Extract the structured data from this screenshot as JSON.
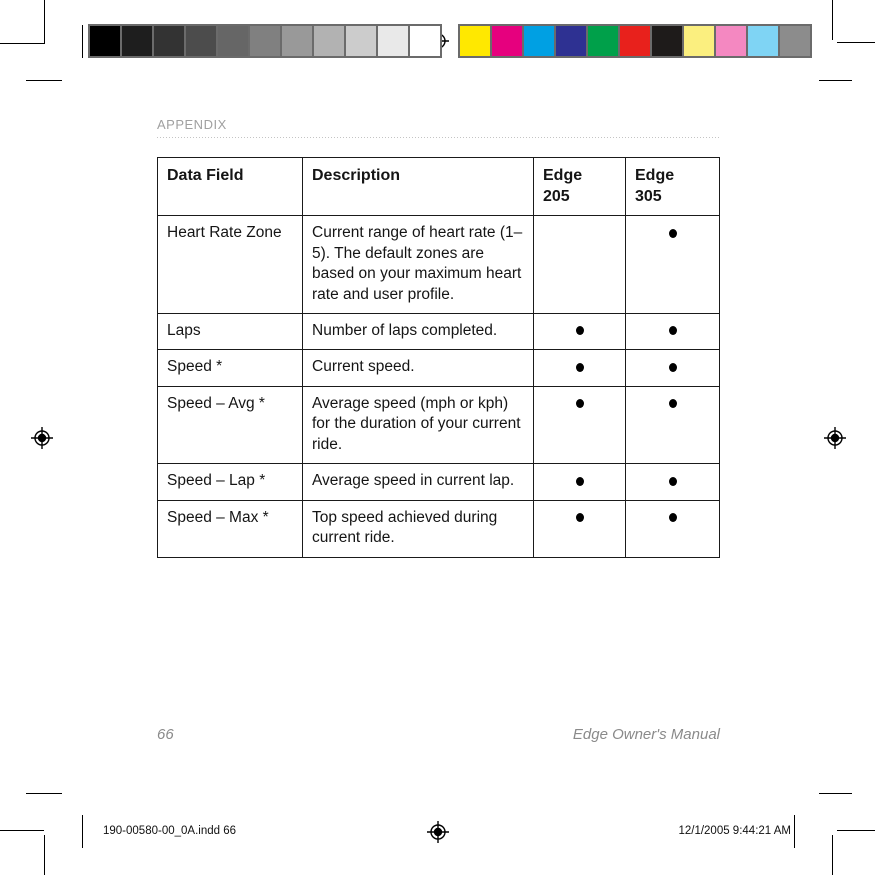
{
  "page": {
    "running_head": "APPENDIX",
    "folio": "66",
    "footer_title": "Edge Owner's Manual"
  },
  "slug": {
    "left": "190-00580-00_0A.indd   66",
    "right": "12/1/2005   9:44:21 AM"
  },
  "table": {
    "headers": [
      "Data Field",
      "Description",
      "Edge\n205",
      "Edge\n305"
    ],
    "header_data_field": "Data Field",
    "header_description": "Description",
    "header_edge205_line1": "Edge",
    "header_edge205_line2": "205",
    "header_edge305_line1": "Edge",
    "header_edge305_line2": "305",
    "rows": [
      {
        "field": "Heart Rate Zone",
        "description": "Current range of heart rate (1–5). The default zones are based on your maximum heart rate and user profile.",
        "edge205": false,
        "edge305": true
      },
      {
        "field": "Laps",
        "description": "Number of laps completed.",
        "edge205": true,
        "edge305": true
      },
      {
        "field": "Speed *",
        "description": "Current speed.",
        "edge205": true,
        "edge305": true
      },
      {
        "field": "Speed – Avg *",
        "description": "Average speed (mph or kph) for the duration of your current ride.",
        "edge205": true,
        "edge305": true
      },
      {
        "field": "Speed – Lap *",
        "description": "Average speed in current lap.",
        "edge205": true,
        "edge305": true
      },
      {
        "field": "Speed – Max *",
        "description": "Top speed achieved during current ride.",
        "edge205": true,
        "edge305": true
      }
    ]
  },
  "calibration": {
    "grayscale_label": "grayscale-step-wedge",
    "grayscale_swatches": [
      "#000000",
      "#1e1e1e",
      "#333333",
      "#4c4c4c",
      "#666666",
      "#808080",
      "#999999",
      "#b2b2b2",
      "#cccccc",
      "#e9e9e9",
      "#ffffff"
    ],
    "color_label": "process-color-bar",
    "color_swatches": [
      "#ffe800",
      "#e6007e",
      "#00a0e3",
      "#2e3192",
      "#00a04a",
      "#e8211c",
      "#1e1b1a",
      "#fbef7f",
      "#f488c1",
      "#7fd4f4",
      "#8c8c8c"
    ],
    "registration_mark": "registration-target-icon"
  }
}
